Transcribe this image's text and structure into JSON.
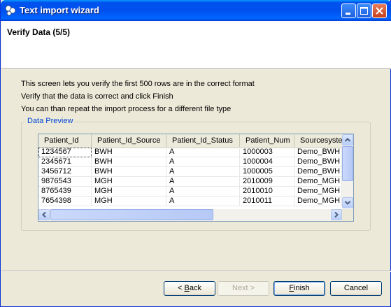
{
  "window": {
    "title": "Text import wizard"
  },
  "header": {
    "title": "Verify Data (5/5)"
  },
  "instructions": [
    "This screen lets you verify the first 500 rows are in the correct format",
    "Verify that the data is correct and click Finish",
    "You can than repeat the import process for a different file type"
  ],
  "preview": {
    "label": "Data Preview",
    "columns": [
      "Patient_Id",
      "Patient_Id_Source",
      "Patient_Id_Status",
      "Patient_Num",
      "Sourcesyste"
    ],
    "rows": [
      [
        "1234567",
        "BWH",
        "A",
        "1000003",
        "Demo_BWH"
      ],
      [
        "2345671",
        "BWH",
        "A",
        "1000004",
        "Demo_BWH"
      ],
      [
        "3456712",
        "BWH",
        "A",
        "1000005",
        "Demo_BWH"
      ],
      [
        "9876543",
        "MGH",
        "A",
        "2010009",
        "Demo_MGH"
      ],
      [
        "8765439",
        "MGH",
        "A",
        "2010010",
        "Demo_MGH"
      ],
      [
        "7654398",
        "MGH",
        "A",
        "2010011",
        "Demo_MGH"
      ]
    ]
  },
  "buttons": {
    "back": {
      "prefix": "< ",
      "mnemonic": "B",
      "rest": "ack"
    },
    "next": "Next >",
    "finish": {
      "mnemonic": "F",
      "rest": "inish"
    },
    "cancel": "Cancel"
  },
  "colors": {
    "titlebar": "#0054e3",
    "group_label": "#0046d5",
    "dialog_bg": "#ece9d8"
  },
  "icons": [
    "app-icon",
    "minimize-icon",
    "maximize-icon",
    "close-icon",
    "arrow-up-icon",
    "arrow-down-icon",
    "arrow-left-icon",
    "arrow-right-icon"
  ]
}
